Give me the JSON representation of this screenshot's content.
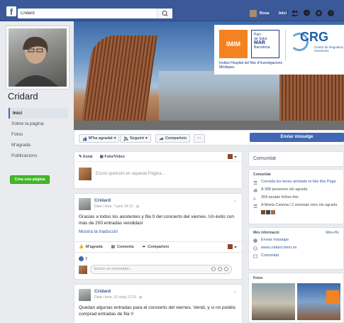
{
  "topbar": {
    "logo": "f",
    "search_value": "Cridard",
    "user_name": "Rosa",
    "home_label": "Inici"
  },
  "profile": {
    "page_name": "Cridard"
  },
  "left_nav": {
    "items": [
      {
        "label": "Inici"
      },
      {
        "label": "Sobre la pàgina"
      },
      {
        "label": "Fotos"
      },
      {
        "label": "M'agrada"
      },
      {
        "label": "Publicacions"
      }
    ],
    "create_page": "Crea una pàgina"
  },
  "cover": {
    "imim_logo": "IMIM",
    "parc_line1": "Parc",
    "parc_line2": "de Salut",
    "parc_line3": "MAR",
    "parc_line4": "Barcelona",
    "imim_text": "Institut Hospital del Mar d'Investigacions Mèdiques",
    "crg": "CRG",
    "crg_sub": "Centre de Regulació Genòmica"
  },
  "action_bar": {
    "like": "M'ha agradat",
    "follow": "Seguint",
    "share": "Comparteix",
    "more": "···",
    "send_message": "Enviar missatge"
  },
  "composer": {
    "tab_status": "Estat",
    "tab_photo": "Foto/Vídeo",
    "placeholder": "Escriu quelcom en aquesta Pàgina..."
  },
  "community": {
    "title": "Comunitat",
    "section": "Comunitat",
    "invite": "Convida les teves amistats to like this Page",
    "likes": "A 308 persones els agrada",
    "follows": "304 people follow this",
    "friends": "A Marta Calsina i 2 amistats més els agrada"
  },
  "more_info": {
    "title": "Més informació",
    "see_all": "Més+Ho",
    "send": "Enviar missatge",
    "website": "www.cridard.imim.es",
    "category": "Comunitat"
  },
  "photos": {
    "title": "Fotos"
  },
  "posts": [
    {
      "author": "Cridard",
      "meta": "Data i hora: 7 juny 14:12 · ",
      "text": "Gracias a todos los asistentes y fila 0 del concierto del viernes. Un éxito con más de 200 entradas vendidas!",
      "link": "Mostra la traducció",
      "like": "M'agrada",
      "comment": "Comenta",
      "share": "Comparteix",
      "like_count": "3",
      "comment_placeholder": "Escriu un comentari..."
    },
    {
      "author": "Cridard",
      "meta": "Data i hora: 31 maig 11:23 · ",
      "text": "Quedan algunas entradas para el concierto del viernes. Venid, y si no podéis comprad entradas de fila 0"
    }
  ]
}
